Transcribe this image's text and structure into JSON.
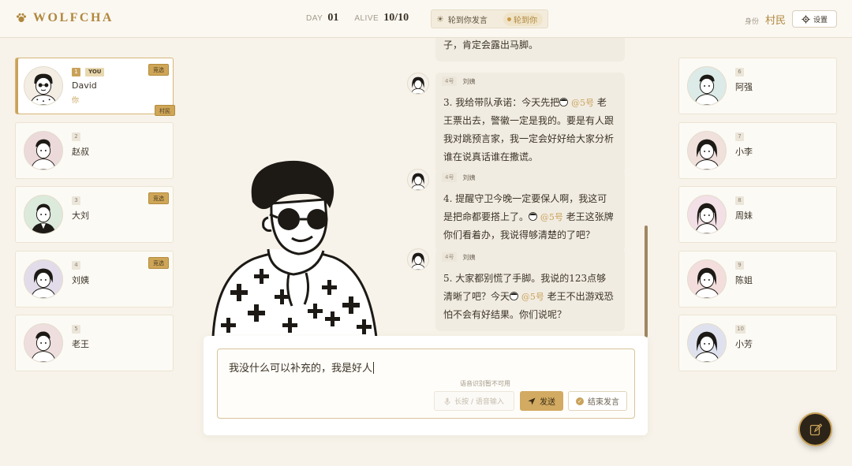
{
  "header": {
    "logo_text": "WOLFCHA",
    "day_label": "DAY",
    "day_value": "01",
    "alive_label": "ALIVE",
    "alive_value": "10/10",
    "turn_text": "轮到你发言",
    "turn_badge": "轮到你",
    "identity_label": "身份",
    "identity_value": "村民",
    "settings_label": "设置"
  },
  "players_left": [
    {
      "num": "1",
      "name": "David",
      "sub": "你",
      "you": "YOU",
      "badge": "竞选",
      "role": "村民"
    },
    {
      "num": "2",
      "name": "赵叔"
    },
    {
      "num": "3",
      "name": "大刘",
      "badge": "竞选"
    },
    {
      "num": "4",
      "name": "刘姨",
      "badge": "竞选"
    },
    {
      "num": "5",
      "name": "老王"
    }
  ],
  "players_right": [
    {
      "num": "6",
      "name": "阿强"
    },
    {
      "num": "7",
      "name": "小李"
    },
    {
      "num": "8",
      "name": "周妹"
    },
    {
      "num": "9",
      "name": "陈姐"
    },
    {
      "num": "10",
      "name": "小芳"
    }
  ],
  "chat": {
    "partial_top": "子，肯定会露出马脚。",
    "messages": [
      {
        "num": "4号",
        "name": "刘姨",
        "pre": "3. 我给带队承诺：今天先把",
        "mention": "@5号",
        "post": "老王票出去，警徽一定是我的。要是有人跟我对跳预言家，我一定会好好给大家分析谁在说真话谁在撒谎。"
      },
      {
        "num": "4号",
        "name": "刘姨",
        "pre": "4. 提醒守卫今晚一定要保人啊，我这可是把命都要搭上了。",
        "mention": "@5号",
        "post": "老王这张牌你们看着办，我说得够清楚的了吧？"
      },
      {
        "num": "4号",
        "name": "刘姨",
        "pre": "5. 大家都别慌了手脚。我说的123点够清晰了吧？今天",
        "mention": "@5号",
        "post": "老王不出游戏恐怕不会有好结果。你们说呢？"
      }
    ]
  },
  "input": {
    "value": "我没什么可以补充的，我是好人",
    "voice_note": "语音识别暂不可用",
    "voice_button": "长按 / 语音输入",
    "send_label": "发送",
    "end_label": "结束发言"
  },
  "colors": {
    "accent": "#c9a25a",
    "background": "#f7f3ea",
    "fab": "#2c2418"
  }
}
